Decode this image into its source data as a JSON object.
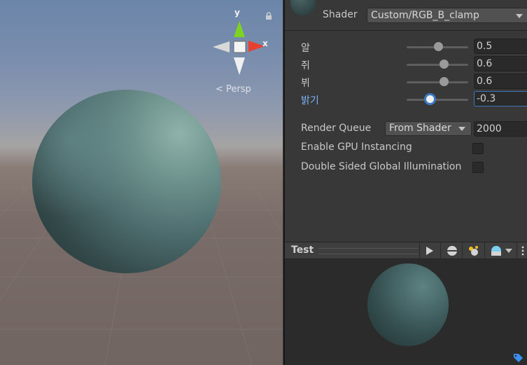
{
  "scene": {
    "gizmo": {
      "y_label": "y",
      "x_label": "x"
    },
    "persp_label": "Persp",
    "icons": [
      "lock-icon",
      "back-arrow-icon"
    ]
  },
  "inspector": {
    "shader": {
      "label": "Shader",
      "value": "Custom/RGB_B_clamp"
    },
    "properties": [
      {
        "label": "알",
        "value": "0.5",
        "slider": 0.5,
        "active": false
      },
      {
        "label": "쥐",
        "value": "0.6",
        "slider": 0.6,
        "active": false
      },
      {
        "label": "뷔",
        "value": "0.6",
        "slider": 0.6,
        "active": false
      },
      {
        "label": "밝기",
        "value": "-0.3",
        "slider": 0.35,
        "active": true
      }
    ],
    "render_queue": {
      "label": "Render Queue",
      "mode": "From Shader",
      "value": "2000"
    },
    "gpu_instancing": {
      "label": "Enable GPU Instancing",
      "checked": false
    },
    "double_sided_gi": {
      "label": "Double Sided Global Illumination",
      "checked": false
    },
    "preview": {
      "title": "Test",
      "icons": [
        "play-icon",
        "sphere-icon",
        "lights-icon",
        "skybox-icon",
        "more-icon"
      ]
    }
  },
  "colors": {
    "accent": "#3a79c1",
    "active_label": "#7ab4f5",
    "x_axis": "#e8402f",
    "y_axis": "#7ed321"
  }
}
